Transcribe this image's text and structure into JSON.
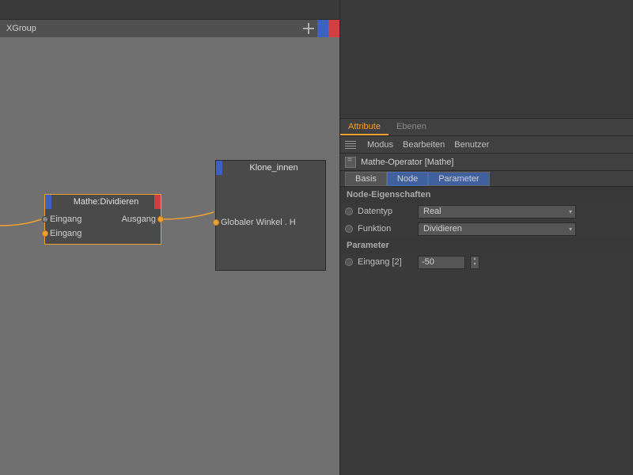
{
  "xgroup": {
    "title": "XGroup"
  },
  "nodes": {
    "math": {
      "title": "Mathe:Dividieren",
      "input1": "Eingang",
      "input2": "Eingang",
      "output": "Ausgang"
    },
    "klone": {
      "title": "Klone_innen",
      "port": "Globaler Winkel . H"
    }
  },
  "tabs": {
    "attribute": "Attribute",
    "ebenen": "Ebenen"
  },
  "menu": {
    "modus": "Modus",
    "bearbeiten": "Bearbeiten",
    "benutzer": "Benutzer"
  },
  "object": {
    "name": "Mathe-Operator [Mathe]"
  },
  "subtabs": {
    "basis": "Basis",
    "node": "Node",
    "parameter": "Parameter"
  },
  "sections": {
    "node_props": "Node-Eigenschaften",
    "parameter": "Parameter"
  },
  "props": {
    "datentyp_label": "Datentyp",
    "datentyp_value": "Real",
    "funktion_label": "Funktion",
    "funktion_value": "Dividieren",
    "eingang_label": "Eingang [2]",
    "eingang_value": "-50"
  },
  "colors": {
    "accent": "#f0a030",
    "blue": "#4060c0",
    "red": "#d04040",
    "bg": "#3a3a3a"
  }
}
